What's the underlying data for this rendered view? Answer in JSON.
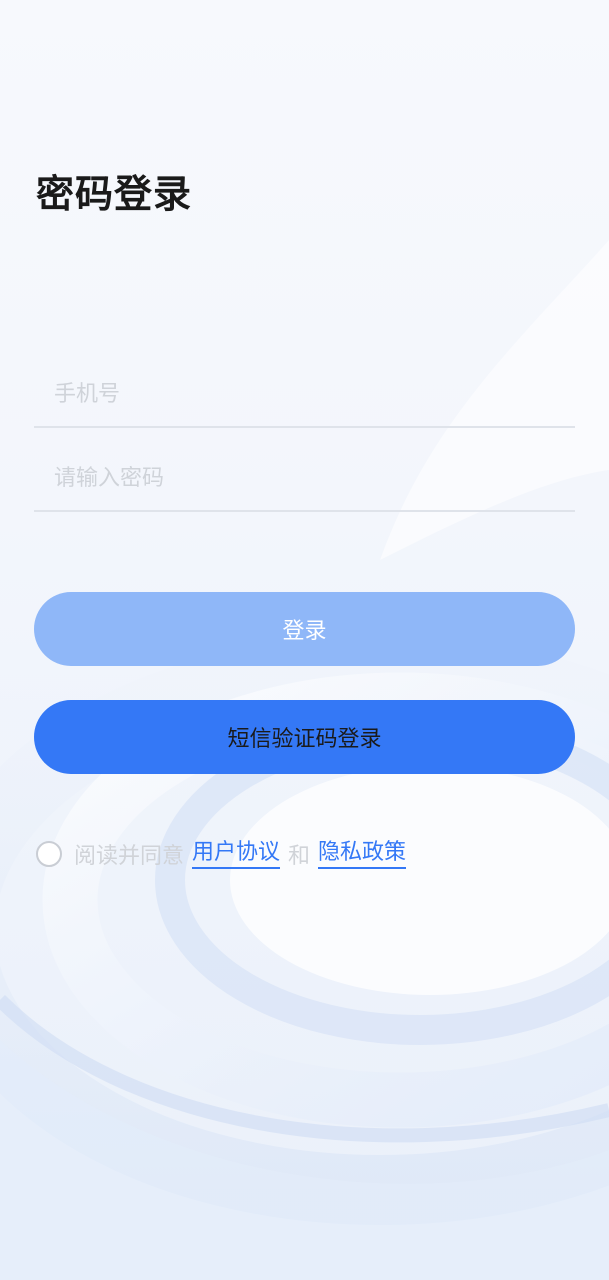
{
  "page": {
    "title": "密码登录"
  },
  "form": {
    "phone_placeholder": "手机号",
    "password_placeholder": "请输入密码"
  },
  "buttons": {
    "login_label": "登录",
    "sms_login_label": "短信验证码登录"
  },
  "agreement": {
    "prefix": "阅读并同意",
    "user_agreement": "用户协议",
    "and": "和",
    "privacy_policy": "隐私政策",
    "checked": false
  },
  "colors": {
    "primary": "#3478f6",
    "primary_disabled": "#8fb7f8",
    "placeholder": "#cfd3d9",
    "divider": "#dfe3ea"
  }
}
